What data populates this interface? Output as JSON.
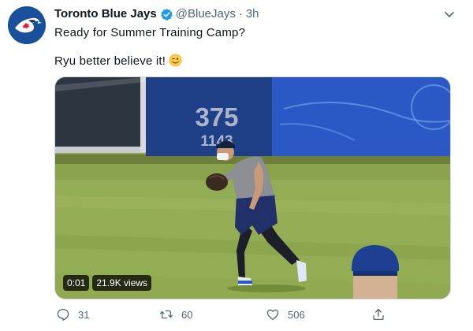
{
  "tweet": {
    "author_name": "Toronto Blue Jays",
    "handle": "@BlueJays",
    "separator": "·",
    "time": "3h",
    "line1": "Ready for Summer Training Camp?",
    "line2": "Ryu better believe it!",
    "verified": true
  },
  "media": {
    "type": "video",
    "timestamp": "0:01",
    "views": "21.9K views",
    "wall_number_top": "375",
    "wall_number_bottom": "1143"
  },
  "actions": {
    "reply_count": "31",
    "retweet_count": "60",
    "like_count": "506"
  },
  "icons": {
    "avatar": "blue-jays-logo-icon",
    "verified": "verified-badge-icon",
    "more": "chevron-down-icon",
    "emoji": "winking-face-icon",
    "reply": "reply-icon",
    "retweet": "retweet-icon",
    "like": "heart-icon",
    "share": "share-icon"
  },
  "colors": {
    "brand_blue": "#1d9bf0",
    "jays_blue": "#1a4f9c",
    "text_secondary": "#536471"
  }
}
